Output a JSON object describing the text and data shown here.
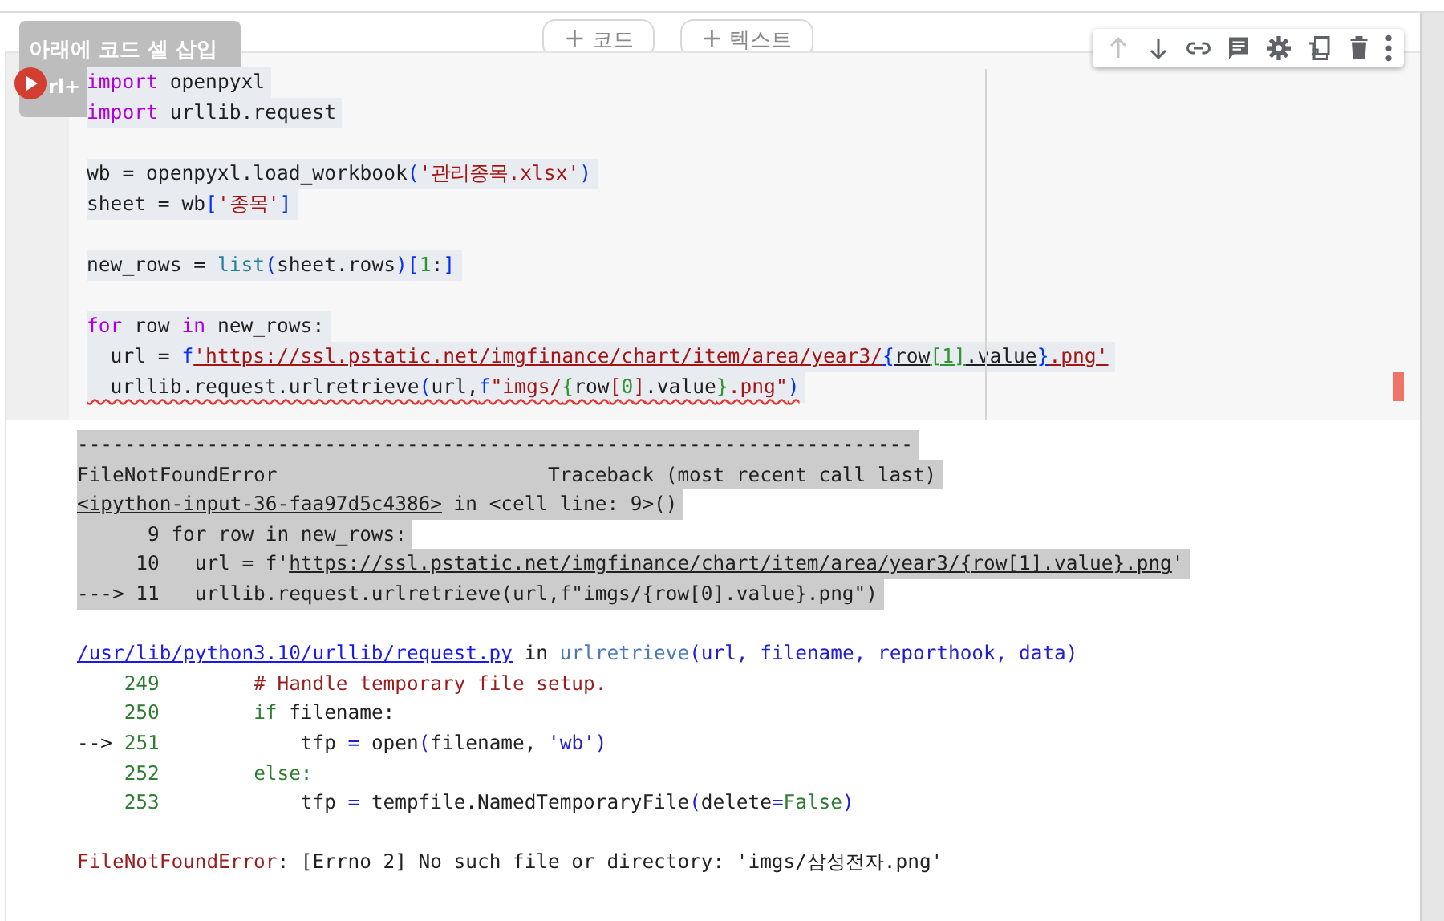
{
  "tooltip": {
    "lines": [
      "아래에 코드 셀 삽입",
      "rl+"
    ]
  },
  "add_buttons": [
    {
      "icon": "+",
      "label": "코드"
    },
    {
      "icon": "+",
      "label": "텍스트"
    }
  ],
  "toolbar": [
    {
      "kind": "up",
      "disabled": true
    },
    {
      "kind": "down",
      "disabled": false
    },
    {
      "kind": "link",
      "disabled": false
    },
    {
      "kind": "comment",
      "disabled": false
    },
    {
      "kind": "gear",
      "disabled": false
    },
    {
      "kind": "mirror",
      "disabled": false
    },
    {
      "kind": "trash",
      "disabled": false
    },
    {
      "kind": "more",
      "disabled": false
    }
  ],
  "code_lines": [
    {
      "kind": "code",
      "squiggle": false,
      "tokens": [
        {
          "kind": "kw",
          "text": "import"
        },
        {
          "kind": "plain",
          "text": " openpyxl"
        }
      ]
    },
    {
      "kind": "code",
      "squiggle": false,
      "tokens": [
        {
          "kind": "kw",
          "text": "import"
        },
        {
          "kind": "plain",
          "text": " urllib.request"
        }
      ]
    },
    {
      "kind": "blank"
    },
    {
      "kind": "code",
      "squiggle": false,
      "tokens": [
        {
          "kind": "plain",
          "text": "wb = openpyxl.load_workbook"
        },
        {
          "kind": "bracket",
          "text": "("
        },
        {
          "kind": "str",
          "text": "'관리종목.xlsx'"
        },
        {
          "kind": "bracket",
          "text": ")"
        }
      ]
    },
    {
      "kind": "code",
      "squiggle": false,
      "tokens": [
        {
          "kind": "plain",
          "text": "sheet = wb"
        },
        {
          "kind": "bracket",
          "text": "["
        },
        {
          "kind": "str",
          "text": "'종목'"
        },
        {
          "kind": "bracket",
          "text": "]"
        }
      ]
    },
    {
      "kind": "blank"
    },
    {
      "kind": "code",
      "squiggle": false,
      "tokens": [
        {
          "kind": "plain",
          "text": "new_rows = "
        },
        {
          "kind": "builtin",
          "text": "list"
        },
        {
          "kind": "bracket",
          "text": "("
        },
        {
          "kind": "plain",
          "text": "sheet.rows"
        },
        {
          "kind": "bracket",
          "text": ")["
        },
        {
          "kind": "num",
          "text": "1"
        },
        {
          "kind": "plain",
          "text": ":"
        },
        {
          "kind": "bracket",
          "text": "]"
        }
      ]
    },
    {
      "kind": "blank"
    },
    {
      "kind": "code",
      "squiggle": false,
      "tokens": [
        {
          "kind": "kw",
          "text": "for"
        },
        {
          "kind": "plain",
          "text": " row "
        },
        {
          "kind": "kw",
          "text": "in"
        },
        {
          "kind": "plain",
          "text": " new_rows:"
        }
      ]
    },
    {
      "kind": "code",
      "squiggle": false,
      "tokens": [
        {
          "kind": "plain",
          "text": "  url = "
        },
        {
          "kind": "bracket",
          "text": "f"
        },
        {
          "kind": "str",
          "text": "'https://ssl.pstatic.net/imgfinance/chart/item/area/year3/",
          "u": true
        },
        {
          "kind": "bracket",
          "text": "{",
          "u": true
        },
        {
          "kind": "plain",
          "text": "row",
          "u": true
        },
        {
          "kind": "num",
          "text": "[1]",
          "u": true
        },
        {
          "kind": "plain",
          "text": ".value",
          "u": true
        },
        {
          "kind": "bracket",
          "text": "}",
          "u": true
        },
        {
          "kind": "str",
          "text": ".png'",
          "u": true
        }
      ]
    },
    {
      "kind": "code",
      "squiggle": true,
      "tokens": [
        {
          "kind": "plain",
          "text": "  urllib.request.urlretrieve"
        },
        {
          "kind": "bracket",
          "text": "("
        },
        {
          "kind": "plain",
          "text": "url,"
        },
        {
          "kind": "bracket",
          "text": "f"
        },
        {
          "kind": "str",
          "text": "\"imgs/"
        },
        {
          "kind": "num",
          "text": "{"
        },
        {
          "kind": "plain",
          "text": "row"
        },
        {
          "kind": "str",
          "text": "["
        },
        {
          "kind": "num",
          "text": "0"
        },
        {
          "kind": "str",
          "text": "]"
        },
        {
          "kind": "plain",
          "text": ".value"
        },
        {
          "kind": "num",
          "text": "}"
        },
        {
          "kind": "str",
          "text": ".png\""
        },
        {
          "kind": "bracket",
          "text": ")"
        }
      ]
    }
  ],
  "output_lines": [
    {
      "kind": "line",
      "highlight": true,
      "tokens": [
        {
          "kind": "text",
          "text": "-----------------------------------------------------------------------"
        }
      ]
    },
    {
      "kind": "line",
      "highlight": true,
      "tokens": [
        {
          "kind": "text",
          "text": "FileNotFoundError                       Traceback (most recent call last)"
        }
      ]
    },
    {
      "kind": "line",
      "highlight": true,
      "tokens": [
        {
          "kind": "link",
          "text": "<ipython-input-36-faa97d5c4386>"
        },
        {
          "kind": "text",
          "text": " in <cell line: 9>()"
        }
      ]
    },
    {
      "kind": "line",
      "highlight": true,
      "tokens": [
        {
          "kind": "text",
          "text": "      9 for row in new_rows:"
        }
      ]
    },
    {
      "kind": "line",
      "highlight": true,
      "tokens": [
        {
          "kind": "text",
          "text": "     10   url = f'"
        },
        {
          "kind": "link",
          "text": "https://ssl.pstatic.net/imgfinance/chart/item/area/year3/{row[1].value}.png"
        },
        {
          "kind": "text",
          "text": "'"
        }
      ]
    },
    {
      "kind": "line",
      "highlight": true,
      "tokens": [
        {
          "kind": "text",
          "text": "---> 11   urllib.request.urlretrieve(url,f\"imgs/{row[0].value}.png\")"
        }
      ]
    },
    {
      "kind": "blank"
    },
    {
      "kind": "line",
      "highlight": false,
      "tokens": [
        {
          "kind": "fileLink",
          "text": "/usr/lib/python3.10/urllib/request.py"
        },
        {
          "kind": "text",
          "text": " in "
        },
        {
          "kind": "fn",
          "text": "urlretrieve"
        },
        {
          "kind": "op",
          "text": "(url, filename, reporthook, data)"
        }
      ]
    },
    {
      "kind": "line",
      "highlight": false,
      "tokens": [
        {
          "kind": "lineno",
          "text": "    249"
        },
        {
          "kind": "comment",
          "text": "        # Handle temporary file setup."
        }
      ]
    },
    {
      "kind": "line",
      "highlight": false,
      "tokens": [
        {
          "kind": "lineno",
          "text": "    250        "
        },
        {
          "kind": "kw",
          "text": "if"
        },
        {
          "kind": "text",
          "text": " filename:"
        }
      ]
    },
    {
      "kind": "line",
      "highlight": false,
      "tokens": [
        {
          "kind": "text",
          "text": "--> "
        },
        {
          "kind": "lineno",
          "text": "251"
        },
        {
          "kind": "text",
          "text": "            tfp "
        },
        {
          "kind": "op",
          "text": "="
        },
        {
          "kind": "text",
          "text": " open"
        },
        {
          "kind": "op",
          "text": "("
        },
        {
          "kind": "text",
          "text": "filename, "
        },
        {
          "kind": "op",
          "text": "'wb')"
        }
      ]
    },
    {
      "kind": "line",
      "highlight": false,
      "tokens": [
        {
          "kind": "lineno",
          "text": "    252        "
        },
        {
          "kind": "kw",
          "text": "else:"
        }
      ]
    },
    {
      "kind": "line",
      "highlight": false,
      "tokens": [
        {
          "kind": "lineno",
          "text": "    253"
        },
        {
          "kind": "text",
          "text": "            tfp "
        },
        {
          "kind": "op",
          "text": "="
        },
        {
          "kind": "text",
          "text": " tempfile.NamedTemporaryFile"
        },
        {
          "kind": "op",
          "text": "("
        },
        {
          "kind": "text",
          "text": "delete"
        },
        {
          "kind": "op",
          "text": "="
        },
        {
          "kind": "kw",
          "text": "False"
        },
        {
          "kind": "op",
          "text": ")"
        }
      ]
    },
    {
      "kind": "blank"
    },
    {
      "kind": "line",
      "highlight": false,
      "tokens": [
        {
          "kind": "err",
          "text": "FileNotFoundError"
        },
        {
          "kind": "text",
          "text": ": [Errno 2] No such file or directory: 'imgs/삼성전자.png'"
        }
      ]
    }
  ]
}
